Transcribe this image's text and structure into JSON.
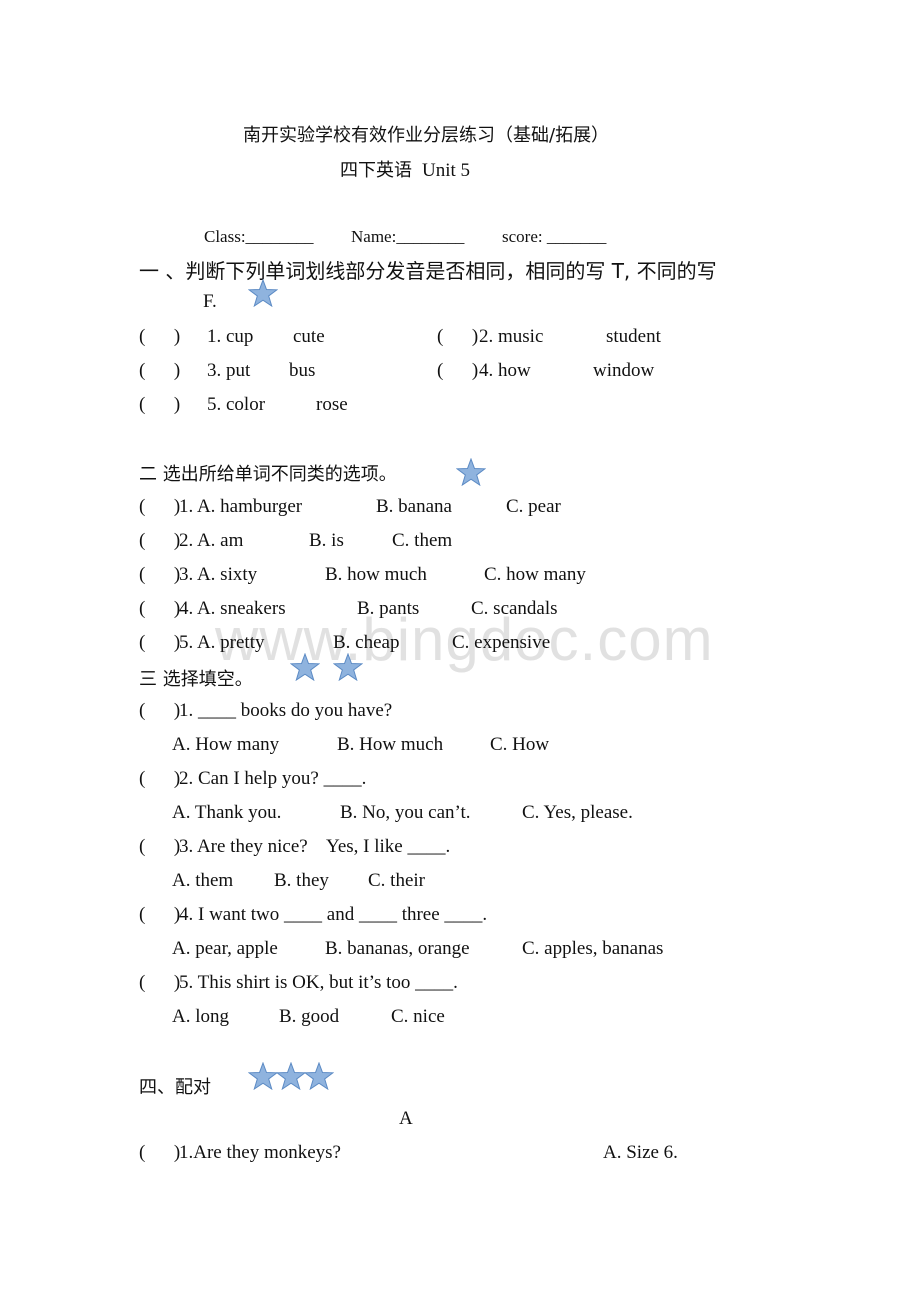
{
  "header": {
    "title": "南开实验学校有效作业分层练习（基础/拓展）",
    "subtitle_cn": "四下英语",
    "subtitle_unit": "Unit 5"
  },
  "info": {
    "class_label": "Class:________",
    "name_label": "Name:________",
    "score_label": "score:  _______"
  },
  "section1": {
    "heading": "一 、判断下列单词划线部分发音是否相同，相同的写 T, 不同的写",
    "heading_cont": "F.",
    "stars": 1,
    "items": [
      {
        "paren": "(      )",
        "num": "1. cup",
        "word": "cute"
      },
      {
        "paren": "(      )",
        "num": "2. music",
        "word": "student"
      },
      {
        "paren": "(      )",
        "num": "3. put",
        "word": "bus"
      },
      {
        "paren": "(      )",
        "num": "4. how",
        "word": "window"
      },
      {
        "paren": "(      )",
        "num": "5. color",
        "word": "rose"
      }
    ]
  },
  "section2": {
    "heading": "二  选出所给单词不同类的选项。",
    "stars": 1,
    "items": [
      {
        "paren": "(      )",
        "q": "1. A. hamburger",
        "b": "B. banana",
        "c": "C. pear"
      },
      {
        "paren": "(      )",
        "q": "2. A. am",
        "b": "B. is",
        "c": "C. them"
      },
      {
        "paren": "(      )",
        "q": "3. A. sixty",
        "b": "B. how much",
        "c": "C. how many"
      },
      {
        "paren": "(      )",
        "q": "4. A. sneakers",
        "b": "B. pants",
        "c": "C. scandals"
      },
      {
        "paren": "(      )",
        "q": "5. A. pretty",
        "b": "B. cheap",
        "c": "C. expensive"
      }
    ]
  },
  "section3": {
    "heading": "三  选择填空。",
    "stars": 2,
    "items": [
      {
        "paren": "(      )",
        "q": "1. ____ books do you have?",
        "a": "A. How many",
        "b": "B. How much",
        "c": "C. How"
      },
      {
        "paren": "(      )",
        "q": "2. Can I help you? ____.",
        "a": "A. Thank you.",
        "b": "B. No, you can’t.",
        "c": "C. Yes, please."
      },
      {
        "paren": "(      )",
        "q": "3. Are they nice?    Yes, I like ____.",
        "a": "A. them",
        "b": "B. they",
        "c": "C. their"
      },
      {
        "paren": "(      )",
        "q": "4. I want two ____ and ____ three ____.",
        "a": "A. pear, apple",
        "b": "B. bananas, orange",
        "c": "C. apples, bananas"
      },
      {
        "paren": "(      )",
        "q": "5. This shirt is OK, but it’s too ____.",
        "a": "A. long",
        "b": "B. good",
        "c": "C. nice"
      }
    ]
  },
  "section4": {
    "heading": "四、配对",
    "stars": 3,
    "column_label": "A",
    "items": [
      {
        "paren": "(      )",
        "q": "1.Are they monkeys?",
        "answer": "A. Size 6."
      }
    ]
  },
  "watermark": "www.bingdoc.com",
  "colors": {
    "star_fill": "#8fb3de",
    "star_stroke": "#5b8ac4",
    "watermark": "#d0d0d0"
  }
}
